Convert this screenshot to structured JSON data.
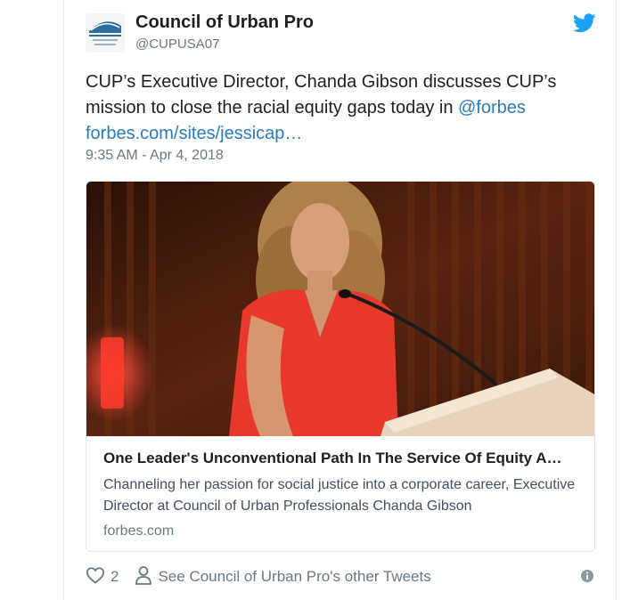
{
  "account": {
    "name": "Council of Urban Pro",
    "handle": "@CUPUSA07",
    "logo_icon": "council-of-urban-professionals-logo"
  },
  "tweet": {
    "text_prefix": "CUP’s Executive Director, Chanda Gibson discusses CUP’s mission to close the racial equity gaps today in ",
    "mention": "@forbes",
    "link": "forbes.com/sites/jessicap…",
    "timestamp": "9:35 AM - Apr 4, 2018"
  },
  "card": {
    "title": "One Leader's Unconventional Path In The Service Of Equity A…",
    "description": "Channeling her passion for social justice into a corporate career, Executive Director at Council of Urban Professionals Chanda Gibson",
    "domain": "forbes.com"
  },
  "actions": {
    "like_count": "2",
    "profile_link": "See Council of Urban Pro's other Tweets"
  },
  "colors": {
    "link": "#2b7bb9",
    "twitter_blue": "#1da1f2",
    "muted": "#697882"
  },
  "icons": [
    "twitter-bird-icon",
    "heart-icon",
    "person-icon",
    "info-icon"
  ]
}
